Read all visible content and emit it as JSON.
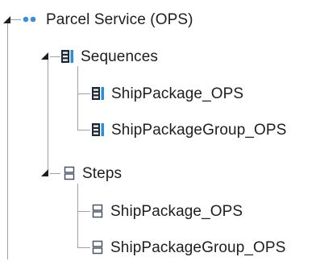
{
  "tree": {
    "root": {
      "label": "Parcel Service (OPS)",
      "icon": "service-dots-icon",
      "expanded": true,
      "children": [
        {
          "label": "Sequences",
          "icon": "sequence-icon",
          "expanded": true,
          "children": [
            {
              "label": "ShipPackage_OPS",
              "icon": "sequence-icon"
            },
            {
              "label": "ShipPackageGroup_OPS",
              "icon": "sequence-icon"
            }
          ]
        },
        {
          "label": "Steps",
          "icon": "step-icon",
          "expanded": true,
          "children": [
            {
              "label": "ShipPackage_OPS",
              "icon": "step-icon"
            },
            {
              "label": "ShipPackageGroup_OPS",
              "icon": "step-icon"
            }
          ]
        }
      ]
    }
  },
  "colors": {
    "connector": "#a0a0a0",
    "toggle": "#1e1e1e",
    "service_dots": "#3d8fd4",
    "sequence_dark": "#1f2937",
    "sequence_accent": "#2a8fd8",
    "step_outline": "#4b5563"
  }
}
